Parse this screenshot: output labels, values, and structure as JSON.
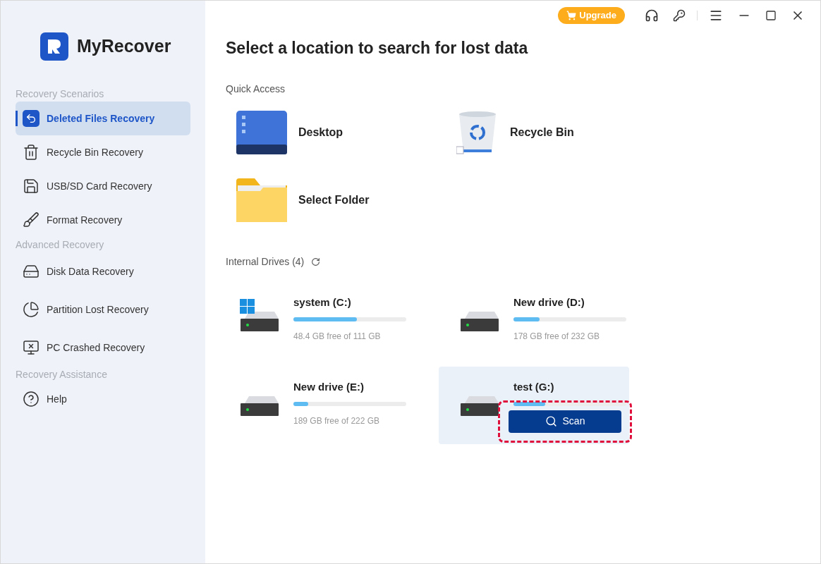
{
  "app": {
    "name": "MyRecover"
  },
  "toolbar": {
    "upgrade": "Upgrade"
  },
  "sidebar": {
    "sections": [
      {
        "title": "Recovery Scenarios",
        "items": [
          {
            "label": "Deleted Files Recovery",
            "selected": true
          },
          {
            "label": "Recycle Bin Recovery",
            "selected": false
          },
          {
            "label": "USB/SD Card Recovery",
            "selected": false
          },
          {
            "label": "Format Recovery",
            "selected": false
          }
        ]
      },
      {
        "title": "Advanced Recovery",
        "items": [
          {
            "label": "Disk Data Recovery",
            "selected": false
          },
          {
            "label": "Partition Lost Recovery",
            "selected": false
          },
          {
            "label": "PC Crashed Recovery",
            "selected": false
          }
        ]
      },
      {
        "title": "Recovery Assistance",
        "items": [
          {
            "label": "Help",
            "selected": false
          }
        ]
      }
    ]
  },
  "main": {
    "heading": "Select a location to search for lost data",
    "quick_access": {
      "title": "Quick Access",
      "items": [
        {
          "label": "Desktop",
          "kind": "desktop"
        },
        {
          "label": "Recycle Bin",
          "kind": "bin"
        },
        {
          "label": "Select Folder",
          "kind": "folder"
        }
      ]
    },
    "drives": {
      "title": "Internal Drives (4)",
      "items": [
        {
          "name": "system (C:)",
          "level": 0.56,
          "size": "48.4 GB free of 111 GB",
          "system": true,
          "selected": false
        },
        {
          "name": "New drive (D:)",
          "level": 0.23,
          "size": "178 GB free of 232 GB",
          "system": false,
          "selected": false
        },
        {
          "name": "New drive (E:)",
          "level": 0.13,
          "size": "189 GB free of 222 GB",
          "system": false,
          "selected": false
        },
        {
          "name": "test (G:)",
          "level": 0.28,
          "system": false,
          "selected": true,
          "scan": "Scan"
        }
      ]
    }
  }
}
